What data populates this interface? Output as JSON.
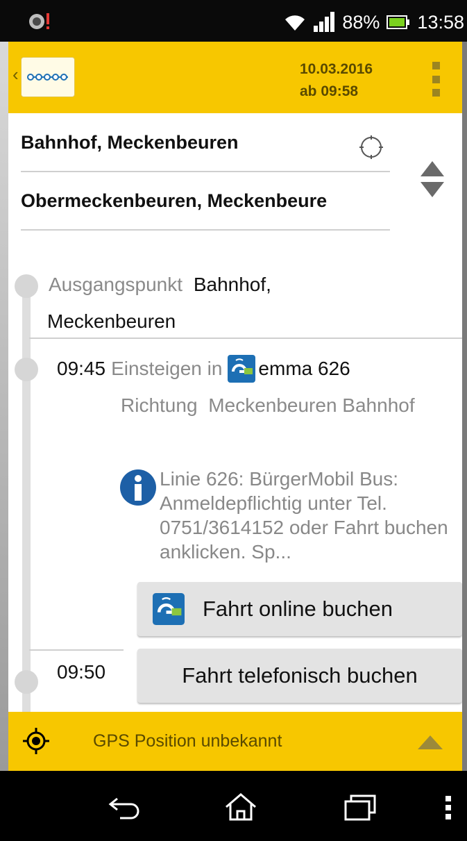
{
  "status_bar": {
    "battery": "88%",
    "time": "13:58",
    "icons": [
      "notification-icon",
      "wifi-icon",
      "signal-icon",
      "battery-icon"
    ]
  },
  "header": {
    "date": "10.03.2016",
    "time": "ab 09:58",
    "icons": [
      "back-chevron-icon",
      "logo",
      "overflow-menu-icon"
    ]
  },
  "search": {
    "from": "Bahnhof, Meckenbeuren",
    "to": "Obermeckenbeuren, Meckenbeure"
  },
  "trip": {
    "start_label": "Ausgangspunkt",
    "start_place_1": "Bahnhof,",
    "start_place_2": "Meckenbeuren",
    "leg": {
      "time": "09:45",
      "action": "Einsteigen in",
      "line": "emma 626",
      "direction_label": "Richtung",
      "direction": "Meckenbeuren Bahnhof"
    },
    "info": "Linie 626: BürgerMobil Bus: Anmeldepflichtig unter Tel. 0751/3614152 oder Fahrt buchen anklicken. Sp...",
    "book_online_label": "Fahrt online buchen",
    "book_phone_label": "Fahrt telefonisch buchen",
    "next_time": "09:50"
  },
  "gps": {
    "status": "GPS Position unbekannt"
  },
  "colors": {
    "accent": "#f7c700",
    "emma_blue": "#1d6fb4",
    "emma_green": "#8cc63f"
  }
}
